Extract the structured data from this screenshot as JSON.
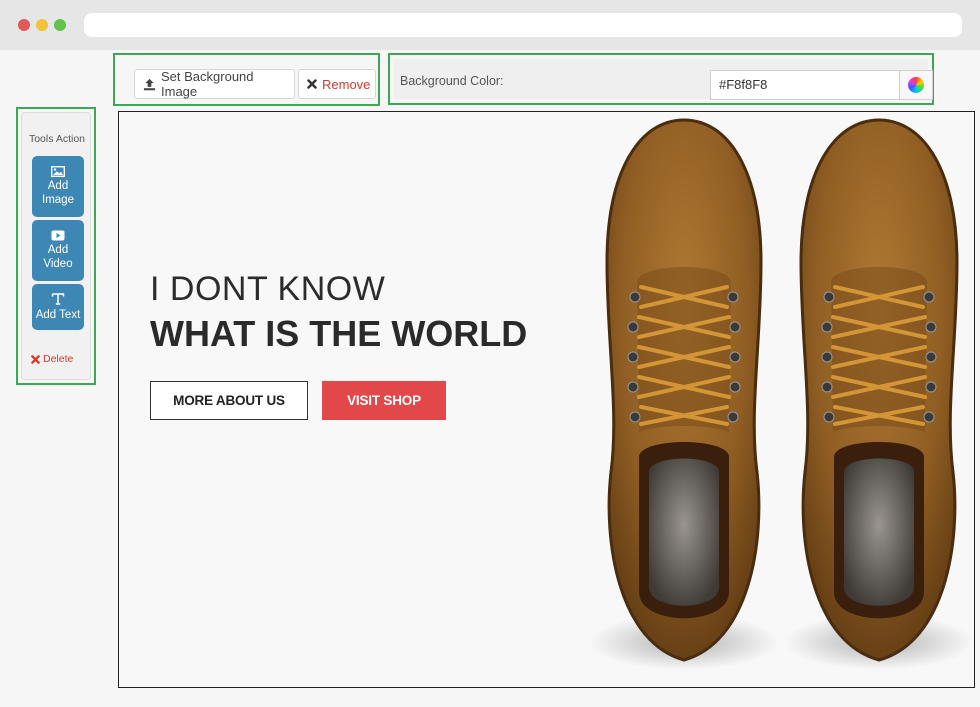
{
  "toolbar": {
    "set_background_label": "Set Background Image",
    "remove_label": "Remove",
    "background_color_label": "Background Color:",
    "background_color_value": "#F8f8F8"
  },
  "tools": {
    "title": "Tools Action",
    "add_image": [
      "Add",
      "Image"
    ],
    "add_video": [
      "Add",
      "Video"
    ],
    "add_text": "Add Text",
    "delete": "Delete"
  },
  "canvas": {
    "headline_light": "I DONT KNOW",
    "headline_bold": "WHAT IS THE WORLD",
    "button_outline": "MORE ABOUT US",
    "button_solid": "VISIT SHOP",
    "background_color": "#F8F8F8"
  },
  "colors": {
    "accent_blue": "#3d87b4",
    "cta_red": "#e2474a",
    "highlight_green": "#3aa955"
  },
  "icons": {
    "upload": "upload-icon",
    "remove": "close-icon",
    "color_picker": "color-wheel-icon",
    "image": "image-icon",
    "video": "video-icon",
    "text": "text-icon",
    "delete": "close-icon"
  }
}
